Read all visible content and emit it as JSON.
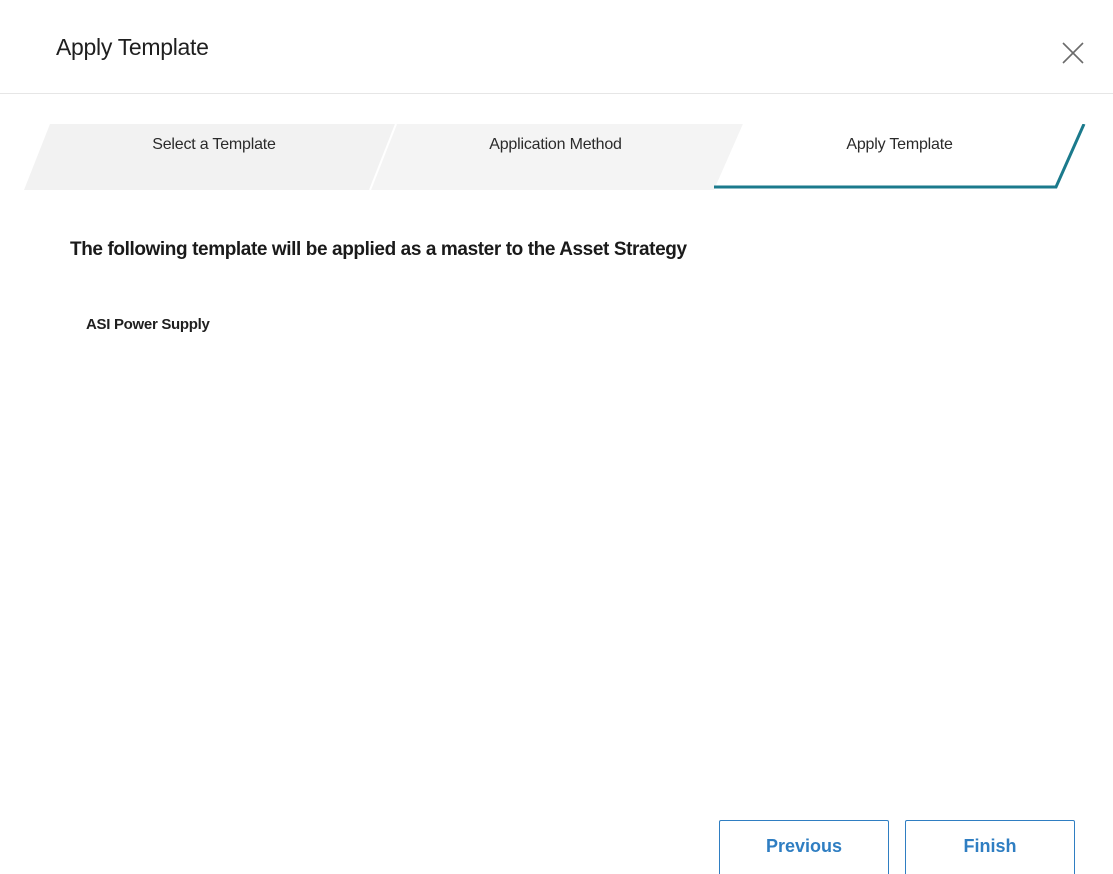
{
  "dialog": {
    "title": "Apply Template",
    "close_icon": "close-icon"
  },
  "wizard": {
    "steps": [
      {
        "label": "Select a Template",
        "state": "complete"
      },
      {
        "label": "Application Method",
        "state": "complete"
      },
      {
        "label": "Apply Template",
        "state": "active"
      }
    ],
    "colors": {
      "inactive_fill": "#f2f2f2",
      "active_accent": "#1b7a8c"
    }
  },
  "content": {
    "message": "The following template will be applied as a master to the Asset Strategy",
    "template_name": "ASI Power Supply"
  },
  "footer": {
    "previous_label": "Previous",
    "finish_label": "Finish",
    "button_color": "#2f7ec2"
  }
}
